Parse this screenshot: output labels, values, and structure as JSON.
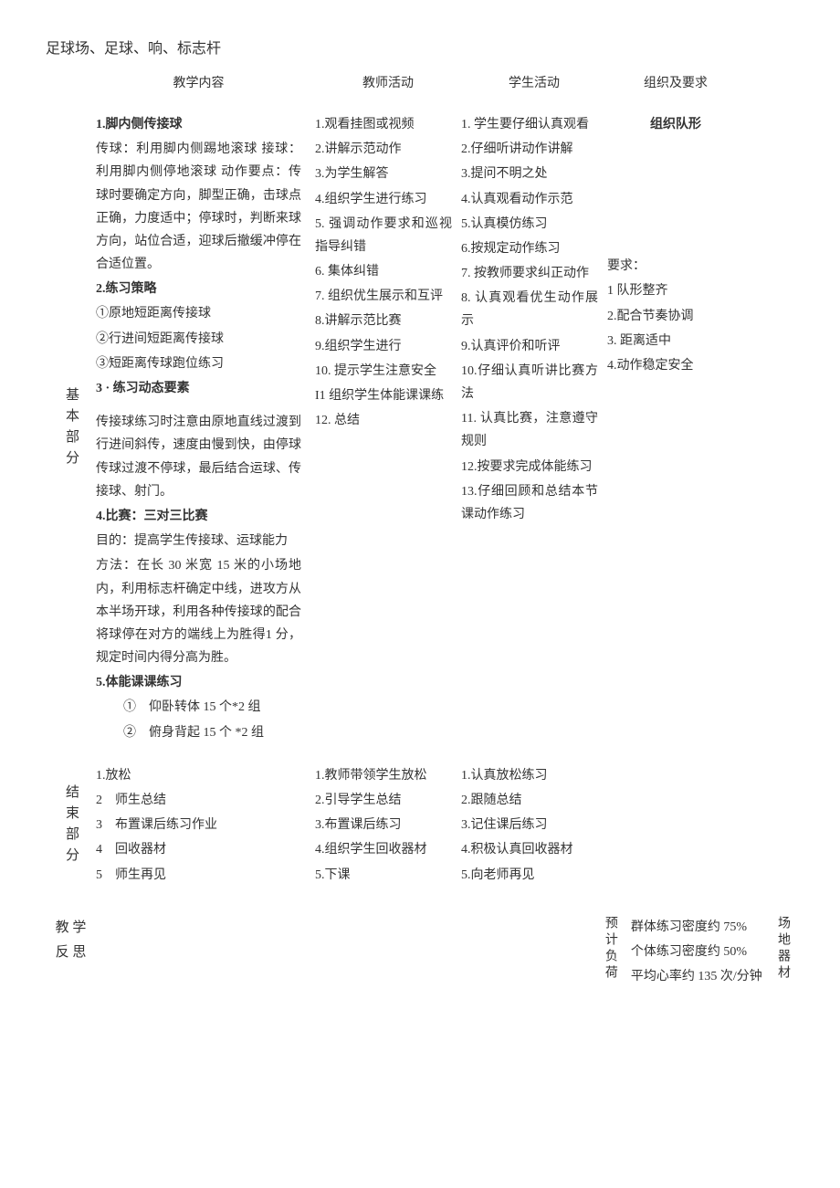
{
  "top_header": "足球场、足球、响、标志杆",
  "headers": {
    "content": "教学内容",
    "teacher": "教师活动",
    "student": "学生活动",
    "org": "组织及要求"
  },
  "main": {
    "section_label": "基本部分",
    "content": {
      "h1": "1.脚内侧传接球",
      "p1": "传球：利用脚内侧踢地滚球 接球：利用脚内侧停地滚球 动作要点：传球时要确定方向，脚型正确，击球点正确，力度适中；停球时，判断来球方向，站位合适，迎球后撤缓冲停在合适位置。",
      "h2": "2.练习策略",
      "p2a": "①原地短距离传接球",
      "p2b": "②行进间短距离传接球",
      "p2c": "③短距离传球跑位练习",
      "h3": "3 · 练习动态要素",
      "p3": "传接球练习时注意由原地直线过渡到行进间斜传，速度由慢到快，由停球传球过渡不停球，最后结合运球、传接球、射门。",
      "h4": "4.比赛：三对三比赛",
      "p4a": "目的：提高学生传接球、运球能力",
      "p4b": "方法：在长 30 米宽 15 米的小场地内，利用标志杆确定中线，进攻方从本半场开球，利用各种传接球的配合将球停在对方的端线上为胜得1 分，规定时间内得分高为胜。",
      "h5": "5.体能课课练习",
      "p5a": "①　仰卧转体 15 个*2 组",
      "p5b": "②　俯身背起 15 个 *2 组"
    },
    "teacher": {
      "t1": "1.观看挂图或视频",
      "t2": "2.讲解示范动作",
      "t3": "3.为学生解答",
      "t4": "4.组织学生进行练习",
      "t5": "5. 强调动作要求和巡视指导纠错",
      "t6": "6. 集体纠错",
      "t7": "7. 组织优生展示和互评",
      "t8": "8.讲解示范比赛",
      "t9": "9.组织学生进行",
      "t10": "10. 提示学生注意安全",
      "t11": "I1 组织学生体能课课练",
      "t12": "12. 总结"
    },
    "student": {
      "s1": "1. 学生要仔细认真观看",
      "s2": "2.仔细听讲动作讲解",
      "s3": "3.提问不明之处",
      "s4": "4.认真观看动作示范",
      "s5": "5.认真模仿练习",
      "s6": "6.按规定动作练习",
      "s7": "7. 按教师要求纠正动作",
      "s8": "8. 认真观看优生动作展示",
      "s9": "9.认真评价和听评",
      "s10": "10.仔细认真听讲比赛方法",
      "s11": "11. 认真比赛，注意遵守规则",
      "s12": "12.按要求完成体能练习",
      "s13": "13.仔细回顾和总结本节课动作练习"
    },
    "org": {
      "title": "组织队形",
      "req_label": "要求：",
      "r1": "1 队形整齐",
      "r2": "2.配合节奏协调",
      "r3": "3. 距离适中",
      "r4": "4.动作稳定安全"
    }
  },
  "end": {
    "section_label": "结束部分",
    "content": {
      "c1": "1.放松",
      "c2": "2　师生总结",
      "c3": "3　布置课后练习作业",
      "c4": "4　回收器材",
      "c5": "5　师生再见"
    },
    "teacher": {
      "t1": "1.教师带领学生放松",
      "t2": "2.引导学生总结",
      "t3": "3.布置课后练习",
      "t4": "4.组织学生回收器材",
      "t5": "5.下课"
    },
    "student": {
      "s1": "1.认真放松练习",
      "s2": "2.跟随总结",
      "s3": "3.记住课后练习",
      "s4": "4.积极认真回收器材",
      "s5": "5.向老师再见"
    }
  },
  "reflect": {
    "label1": "教 学",
    "label2": "反 思",
    "load_label": "预计负荷",
    "load1": "群体练习密度约 75%",
    "load2": "个体练习密度约 50%",
    "load3": "平均心率约 135 次/分钟",
    "venue_label": "场地器材"
  }
}
